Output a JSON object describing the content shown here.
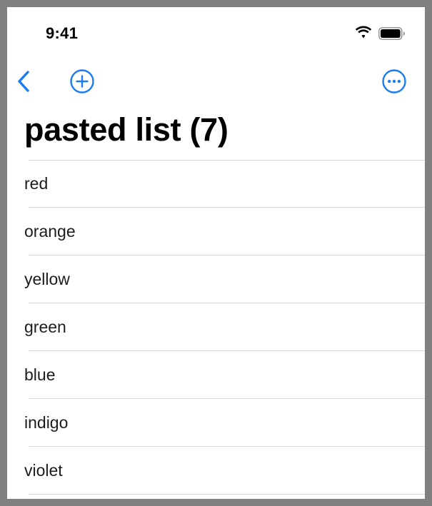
{
  "status_bar": {
    "time": "9:41",
    "icons": [
      "wifi-icon",
      "battery-icon"
    ]
  },
  "nav": {
    "back_icon": "chevron-left-icon",
    "add_icon": "plus-circle-icon",
    "more_icon": "ellipsis-circle-icon",
    "accent_color": "#1a7cf0"
  },
  "list": {
    "title": "pasted list (7)",
    "items": [
      {
        "label": "red"
      },
      {
        "label": "orange"
      },
      {
        "label": "yellow"
      },
      {
        "label": "green"
      },
      {
        "label": "blue"
      },
      {
        "label": "indigo"
      },
      {
        "label": "violet"
      }
    ]
  }
}
